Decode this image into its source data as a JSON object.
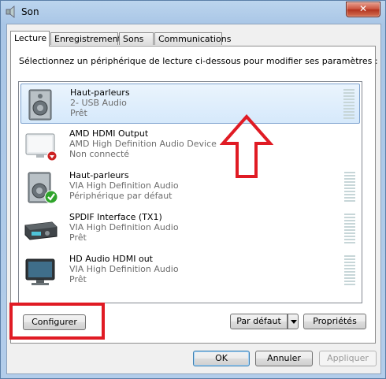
{
  "window": {
    "title": "Son",
    "close_label": "✕"
  },
  "tabs": [
    {
      "label": "Lecture",
      "active": true
    },
    {
      "label": "Enregistrement",
      "active": false
    },
    {
      "label": "Sons",
      "active": false
    },
    {
      "label": "Communications",
      "active": false
    }
  ],
  "instruction": "Sélectionnez un périphérique de lecture ci-dessous pour modifier ses paramètres :",
  "devices": [
    {
      "name": "Haut-parleurs",
      "description": "2- USB Audio",
      "status": "Prêt",
      "icon": "speaker-icon",
      "selected": true
    },
    {
      "name": "AMD HDMI Output",
      "description": "AMD High Definition Audio Device",
      "status": "Non connecté",
      "icon": "monitor-disconnected-icon",
      "selected": false
    },
    {
      "name": "Haut-parleurs",
      "description": "VIA High Definition Audio",
      "status": "Périphérique par défaut",
      "icon": "speaker-default-icon",
      "selected": false
    },
    {
      "name": "SPDIF Interface (TX1)",
      "description": "VIA High Definition Audio",
      "status": "Prêt",
      "icon": "spdif-receiver-icon",
      "selected": false
    },
    {
      "name": "HD Audio HDMI out",
      "description": "VIA High Definition Audio",
      "status": "Prêt",
      "icon": "monitor-icon",
      "selected": false
    }
  ],
  "buttons": {
    "configure": "Configurer",
    "set_default": "Par défaut",
    "properties": "Propriétés",
    "ok": "OK",
    "cancel": "Annuler",
    "apply": "Appliquer"
  },
  "colors": {
    "annotation": "#e01b24",
    "selection": "#d6e9fb"
  }
}
